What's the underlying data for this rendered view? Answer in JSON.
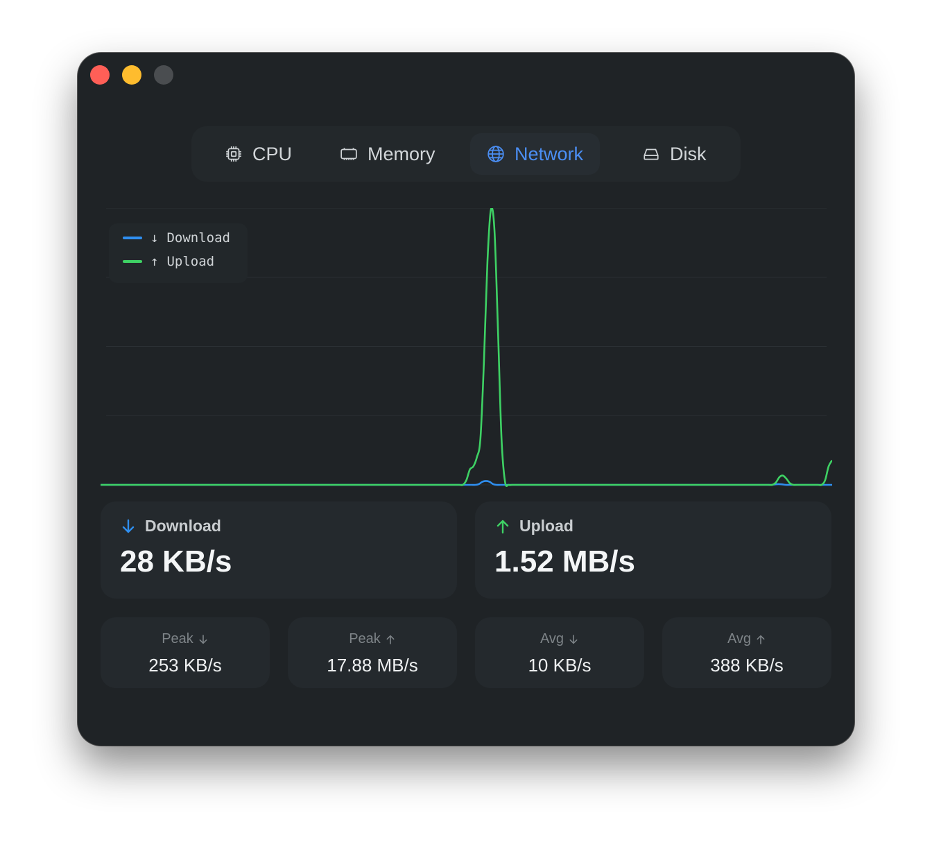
{
  "window": {
    "traffic_lights": [
      "close",
      "minimize",
      "zoom"
    ]
  },
  "tabs": [
    {
      "label": "CPU",
      "icon": "cpu-icon",
      "active": false
    },
    {
      "label": "Memory",
      "icon": "memory-icon",
      "active": false
    },
    {
      "label": "Network",
      "icon": "globe-icon",
      "active": true
    },
    {
      "label": "Disk",
      "icon": "disk-icon",
      "active": false
    }
  ],
  "colors": {
    "accent": "#4b8ff5",
    "download": "#2f8ff0",
    "upload": "#3ed164",
    "background": "#1f2326",
    "card": "#24292d"
  },
  "chart_data": {
    "type": "line",
    "grid": true,
    "legend_position": "top-left",
    "ylim": [
      0,
      17.88
    ],
    "y_unit": "MB/s",
    "series": [
      {
        "name": "Download",
        "arrow": "↓",
        "color": "#2f8ff0",
        "values": [
          0,
          0,
          0,
          0,
          0,
          0,
          0,
          0,
          0,
          0,
          0,
          0,
          0,
          0,
          0,
          0,
          0,
          0,
          0,
          0,
          0,
          0,
          0,
          0,
          0,
          0,
          0,
          0,
          0,
          0,
          0,
          0,
          0,
          0,
          0,
          0,
          0,
          0,
          0,
          0,
          0,
          0,
          0,
          0,
          0,
          0,
          0,
          0,
          0,
          0,
          0,
          0,
          0,
          0,
          0,
          0,
          0,
          0,
          0,
          0,
          0,
          0,
          0,
          0,
          0,
          0,
          0,
          0,
          0,
          0,
          0,
          0,
          0,
          0,
          0,
          0,
          0,
          0,
          0,
          0,
          0,
          0,
          0,
          0,
          0,
          0,
          0,
          0,
          0,
          0,
          0,
          0,
          0,
          0,
          0,
          0,
          0,
          0,
          0,
          0,
          0,
          0,
          0,
          0,
          0,
          0,
          0.05,
          0.2,
          0.25,
          0.2,
          0.05,
          0,
          0,
          0,
          0,
          0,
          0,
          0,
          0,
          0,
          0,
          0,
          0,
          0,
          0,
          0,
          0,
          0,
          0,
          0,
          0,
          0,
          0,
          0,
          0,
          0,
          0,
          0,
          0,
          0,
          0,
          0,
          0,
          0,
          0,
          0,
          0,
          0,
          0,
          0,
          0,
          0,
          0,
          0,
          0,
          0,
          0,
          0,
          0,
          0,
          0,
          0,
          0,
          0,
          0,
          0,
          0,
          0,
          0,
          0,
          0,
          0,
          0,
          0,
          0,
          0,
          0,
          0,
          0,
          0,
          0,
          0,
          0,
          0,
          0,
          0,
          0,
          0,
          0,
          0.03,
          0.05,
          0.03,
          0,
          0,
          0,
          0,
          0,
          0,
          0,
          0,
          0,
          0,
          0,
          0,
          0,
          0
        ]
      },
      {
        "name": "Upload",
        "arrow": "↑",
        "color": "#3ed164",
        "values": [
          0,
          0,
          0,
          0,
          0,
          0,
          0,
          0,
          0,
          0,
          0,
          0,
          0,
          0,
          0,
          0,
          0,
          0,
          0,
          0,
          0,
          0,
          0,
          0,
          0,
          0,
          0,
          0,
          0,
          0,
          0,
          0,
          0,
          0,
          0,
          0,
          0,
          0,
          0,
          0,
          0,
          0,
          0,
          0,
          0,
          0,
          0,
          0,
          0,
          0,
          0,
          0,
          0,
          0,
          0,
          0,
          0,
          0,
          0,
          0,
          0,
          0,
          0,
          0,
          0,
          0,
          0,
          0,
          0,
          0,
          0,
          0,
          0,
          0,
          0,
          0,
          0,
          0,
          0,
          0,
          0,
          0,
          0,
          0,
          0,
          0,
          0,
          0,
          0,
          0,
          0,
          0,
          0,
          0,
          0,
          0,
          0,
          0,
          0,
          0,
          0,
          0,
          0,
          0,
          0.3,
          1.0,
          1.2,
          1.8,
          3.0,
          8.0,
          14.5,
          17.88,
          16.5,
          10.0,
          3.0,
          0.2,
          0,
          0,
          0,
          0,
          0,
          0,
          0,
          0,
          0,
          0,
          0,
          0,
          0,
          0,
          0,
          0,
          0,
          0,
          0,
          0,
          0,
          0,
          0,
          0,
          0,
          0,
          0,
          0,
          0,
          0,
          0,
          0,
          0,
          0,
          0,
          0,
          0,
          0,
          0,
          0,
          0,
          0,
          0,
          0,
          0,
          0,
          0,
          0,
          0,
          0,
          0,
          0,
          0,
          0,
          0,
          0,
          0,
          0,
          0,
          0,
          0,
          0,
          0,
          0,
          0,
          0,
          0,
          0,
          0,
          0,
          0,
          0,
          0,
          0,
          0,
          0,
          0.15,
          0.5,
          0.6,
          0.4,
          0.1,
          0,
          0,
          0,
          0,
          0,
          0,
          0,
          0,
          0,
          0.3,
          1.2,
          1.6
        ]
      }
    ]
  },
  "current": {
    "download": {
      "label": "Download",
      "value": "28 KB/s"
    },
    "upload": {
      "label": "Upload",
      "value": "1.52 MB/s"
    }
  },
  "stats": [
    {
      "label": "Peak",
      "arrow": "down",
      "value": "253 KB/s"
    },
    {
      "label": "Peak",
      "arrow": "up",
      "value": "17.88 MB/s"
    },
    {
      "label": "Avg",
      "arrow": "down",
      "value": "10 KB/s"
    },
    {
      "label": "Avg",
      "arrow": "up",
      "value": "388 KB/s"
    }
  ]
}
